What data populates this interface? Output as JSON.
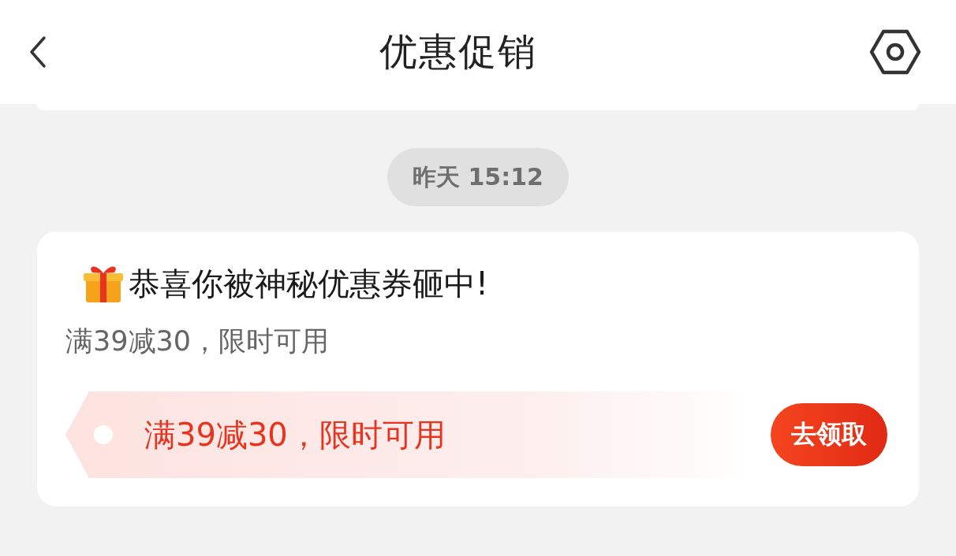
{
  "header": {
    "title": "优惠促销"
  },
  "messages": [
    {
      "time": "昨天 15:12",
      "title": "恭喜你被神秘优惠券砸中!",
      "subtitle": "满39减30，限时可用",
      "coupon": {
        "text": "满39减30，限时可用",
        "button": "去领取"
      }
    }
  ]
}
